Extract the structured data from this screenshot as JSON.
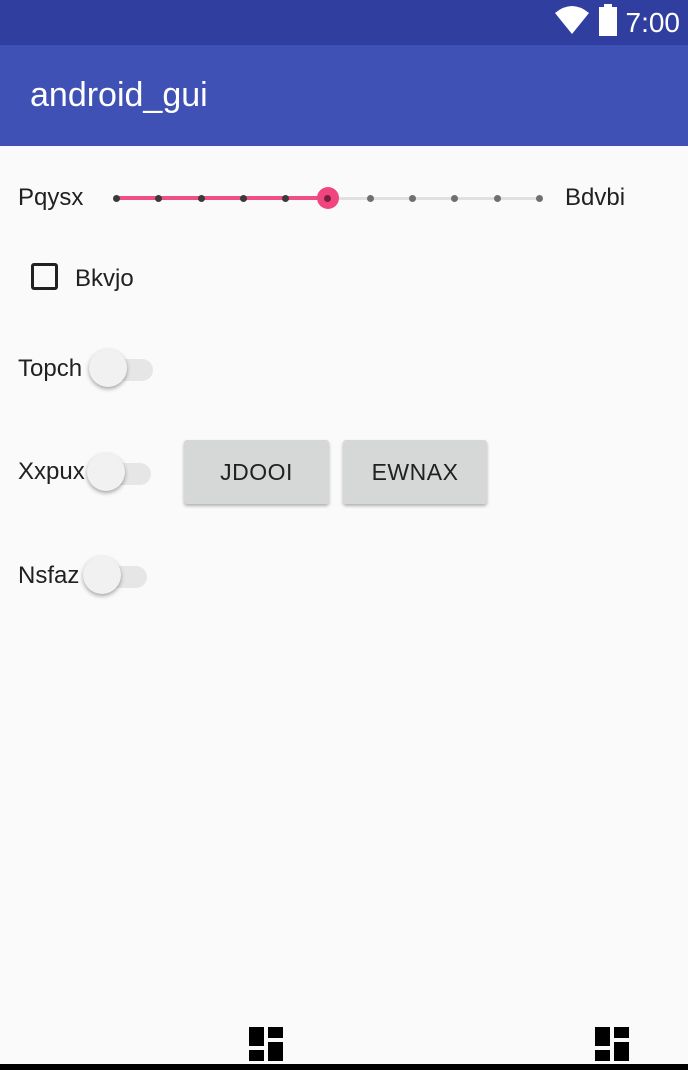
{
  "status_bar": {
    "time": "7:00",
    "icons": [
      "wifi-icon",
      "battery-icon"
    ]
  },
  "app_bar": {
    "title": "android_gui"
  },
  "seekbar": {
    "start_label": "Pqysx",
    "end_label": "Bdvbi",
    "value": 5,
    "max": 10
  },
  "checkbox": {
    "label": "Bkvjo",
    "checked": false
  },
  "switches": [
    {
      "label": "Topch",
      "on": false
    },
    {
      "label": "Xxpux",
      "on": false
    },
    {
      "label": "Nsfaz",
      "on": false
    }
  ],
  "buttons": [
    {
      "label": "JDOOI"
    },
    {
      "label": "EWNAX"
    }
  ],
  "colors": {
    "status_bar": "#303f9f",
    "app_bar": "#3f51b5",
    "accent": "#ef4f86",
    "background": "#fafafa"
  },
  "bottom_icons": [
    "dashboard-icon",
    "dashboard-icon"
  ]
}
